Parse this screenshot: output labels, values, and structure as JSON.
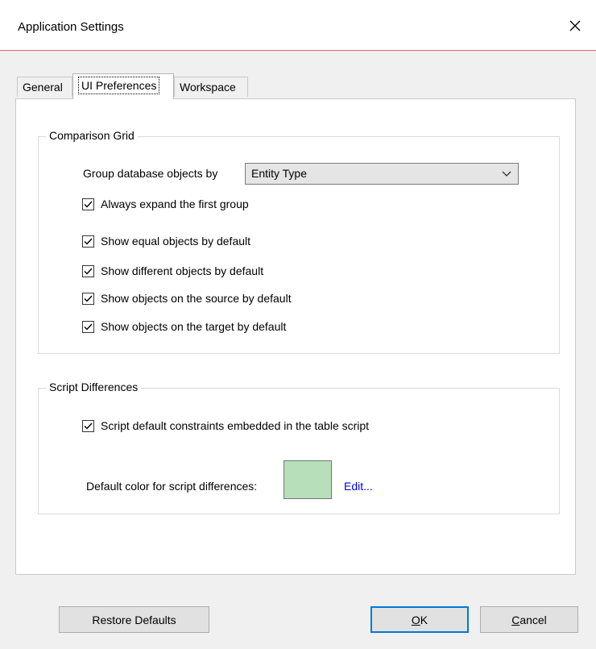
{
  "window": {
    "title": "Application Settings",
    "close_icon": "close-icon"
  },
  "tabs": [
    {
      "label": "General",
      "active": false
    },
    {
      "label": "UI Preferences",
      "active": true
    },
    {
      "label": "Workspace",
      "active": false
    }
  ],
  "comparison_grid": {
    "title": "Comparison Grid",
    "group_by_label": "Group database objects by",
    "group_by_value": "Entity Type",
    "checkboxes": [
      {
        "label": "Always expand the first group",
        "checked": true
      },
      {
        "label": "Show equal objects by default",
        "checked": true
      },
      {
        "label": "Show different objects by default",
        "checked": true
      },
      {
        "label": "Show objects on the source by default",
        "checked": true
      },
      {
        "label": "Show objects on the target by default",
        "checked": true
      }
    ]
  },
  "script_differences": {
    "title": "Script Differences",
    "checkbox": {
      "label": "Script default constraints embedded in the table script",
      "checked": true
    },
    "color_label": "Default color for script differences:",
    "color_value": "#b6dfba",
    "edit_link": "Edit..."
  },
  "footer": {
    "restore_defaults": "Restore Defaults",
    "ok": "OK",
    "cancel": "Cancel"
  },
  "colors": {
    "title_separator": "#e06464",
    "default_button_border": "#0078d7",
    "link": "#0000ee"
  }
}
